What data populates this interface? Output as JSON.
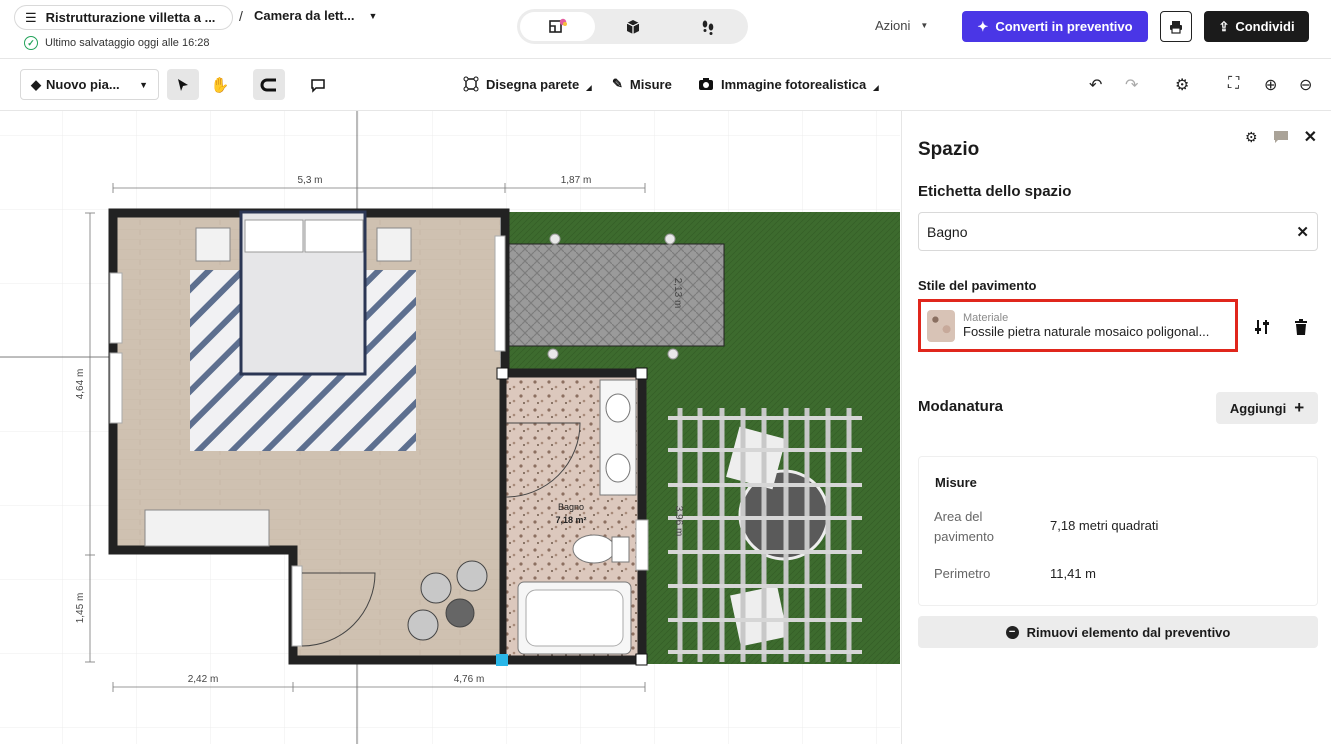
{
  "header": {
    "project_name": "Ristrutturazione villetta a ...",
    "separator": "/",
    "room_name": "Camera da lett...",
    "save_status": "Ultimo salvataggio oggi alle 16:28",
    "actions_label": "Azioni",
    "convert_label": "Converti in preventivo",
    "share_label": "Condividi"
  },
  "view_switch": {
    "active": "2d"
  },
  "toolbar": {
    "floor_label": "Nuovo pia...",
    "draw_wall": "Disegna parete",
    "measure": "Misure",
    "photo": "Immagine fotorealistica"
  },
  "plan": {
    "dim_top_1": "5,3 m",
    "dim_top_2": "1,87 m",
    "dim_left_1": "4,64 m",
    "dim_left_2": "1,45 m",
    "dim_bottom_1": "2,42 m",
    "dim_bottom_2": "4,76 m",
    "dim_patio": "2,13 m",
    "dim_pergola": "3,96 m",
    "room_label": "Bagno",
    "room_area": "7,18 m²"
  },
  "panel": {
    "title": "Spazio",
    "space_label_title": "Etichetta dello spazio",
    "space_label_value": "Bagno",
    "floor_style_title": "Stile del pavimento",
    "material_caption": "Materiale",
    "material_name": "Fossile pietra naturale mosaico poligonal...",
    "molding_title": "Modanatura",
    "add_label": "Aggiungi",
    "measures_title": "Misure",
    "area_label": "Area del pavimento",
    "area_value": "7,18 metri quadrati",
    "perimeter_label": "Perimetro",
    "perimeter_value": "11,41 m",
    "remove_label": "Rimuovi elemento dal preventivo"
  },
  "colors": {
    "accent": "#4a36e6",
    "highlight_border": "#e0261c",
    "lawn": "#3d6b2e",
    "wall": "#222222",
    "wood_floor": "#cdbfb0"
  }
}
